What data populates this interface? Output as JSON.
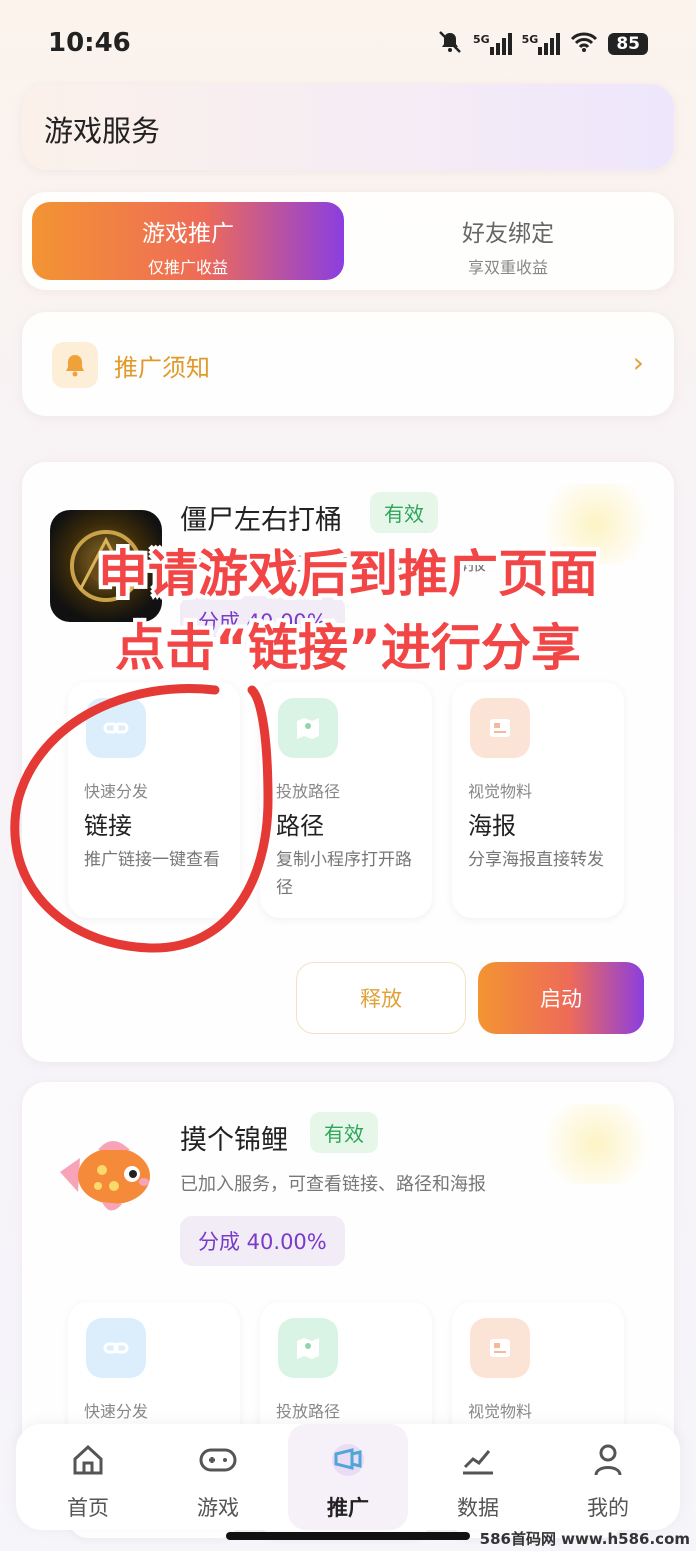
{
  "status_bar": {
    "time": "10:46",
    "network_1": "5G",
    "network_2": "5G",
    "battery": "85"
  },
  "header": {
    "title": "游戏服务"
  },
  "tabs": [
    {
      "title": "游戏推广",
      "subtitle": "仅推广收益"
    },
    {
      "title": "好友绑定",
      "subtitle": "享双重收益"
    }
  ],
  "notice": {
    "label": "推广须知",
    "chevron": "›"
  },
  "games": [
    {
      "name": "僵尸左右打桶",
      "badge": "有效",
      "description": "已加入服务，可查看链接、路径和海报",
      "share": "分成 40.00%",
      "tools": [
        {
          "kicker": "快速分发",
          "name": "链接",
          "desc": "推广链接一键查看"
        },
        {
          "kicker": "投放路径",
          "name": "路径",
          "desc": "复制小程序打开路径"
        },
        {
          "kicker": "视觉物料",
          "name": "海报",
          "desc": "分享海报直接转发"
        }
      ],
      "actions": {
        "release": "释放",
        "start": "启动"
      }
    },
    {
      "name": "摸个锦鲤",
      "badge": "有效",
      "description": "已加入服务，可查看链接、路径和海报",
      "share": "分成 40.00%",
      "tools": [
        {
          "kicker": "快速分发"
        },
        {
          "kicker": "投放路径"
        },
        {
          "kicker": "视觉物料"
        }
      ]
    }
  ],
  "overlay": {
    "line1": "申请游戏后到推广页面",
    "line2": "点击“链接”进行分享"
  },
  "bottom_nav": [
    {
      "label": "首页",
      "icon": "home-icon"
    },
    {
      "label": "游戏",
      "icon": "gamepad-icon"
    },
    {
      "label": "推广",
      "icon": "megaphone-icon",
      "active": true
    },
    {
      "label": "数据",
      "icon": "chart-icon"
    },
    {
      "label": "我的",
      "icon": "user-icon"
    }
  ],
  "watermark": "586首码网 www.h586.com",
  "colors": {
    "accent_orange": "#f39432",
    "accent_purple": "#8b3ee0",
    "valid_green": "#2da55a",
    "notice_gold": "#e09a2a",
    "overlay_red": "#f24545"
  }
}
